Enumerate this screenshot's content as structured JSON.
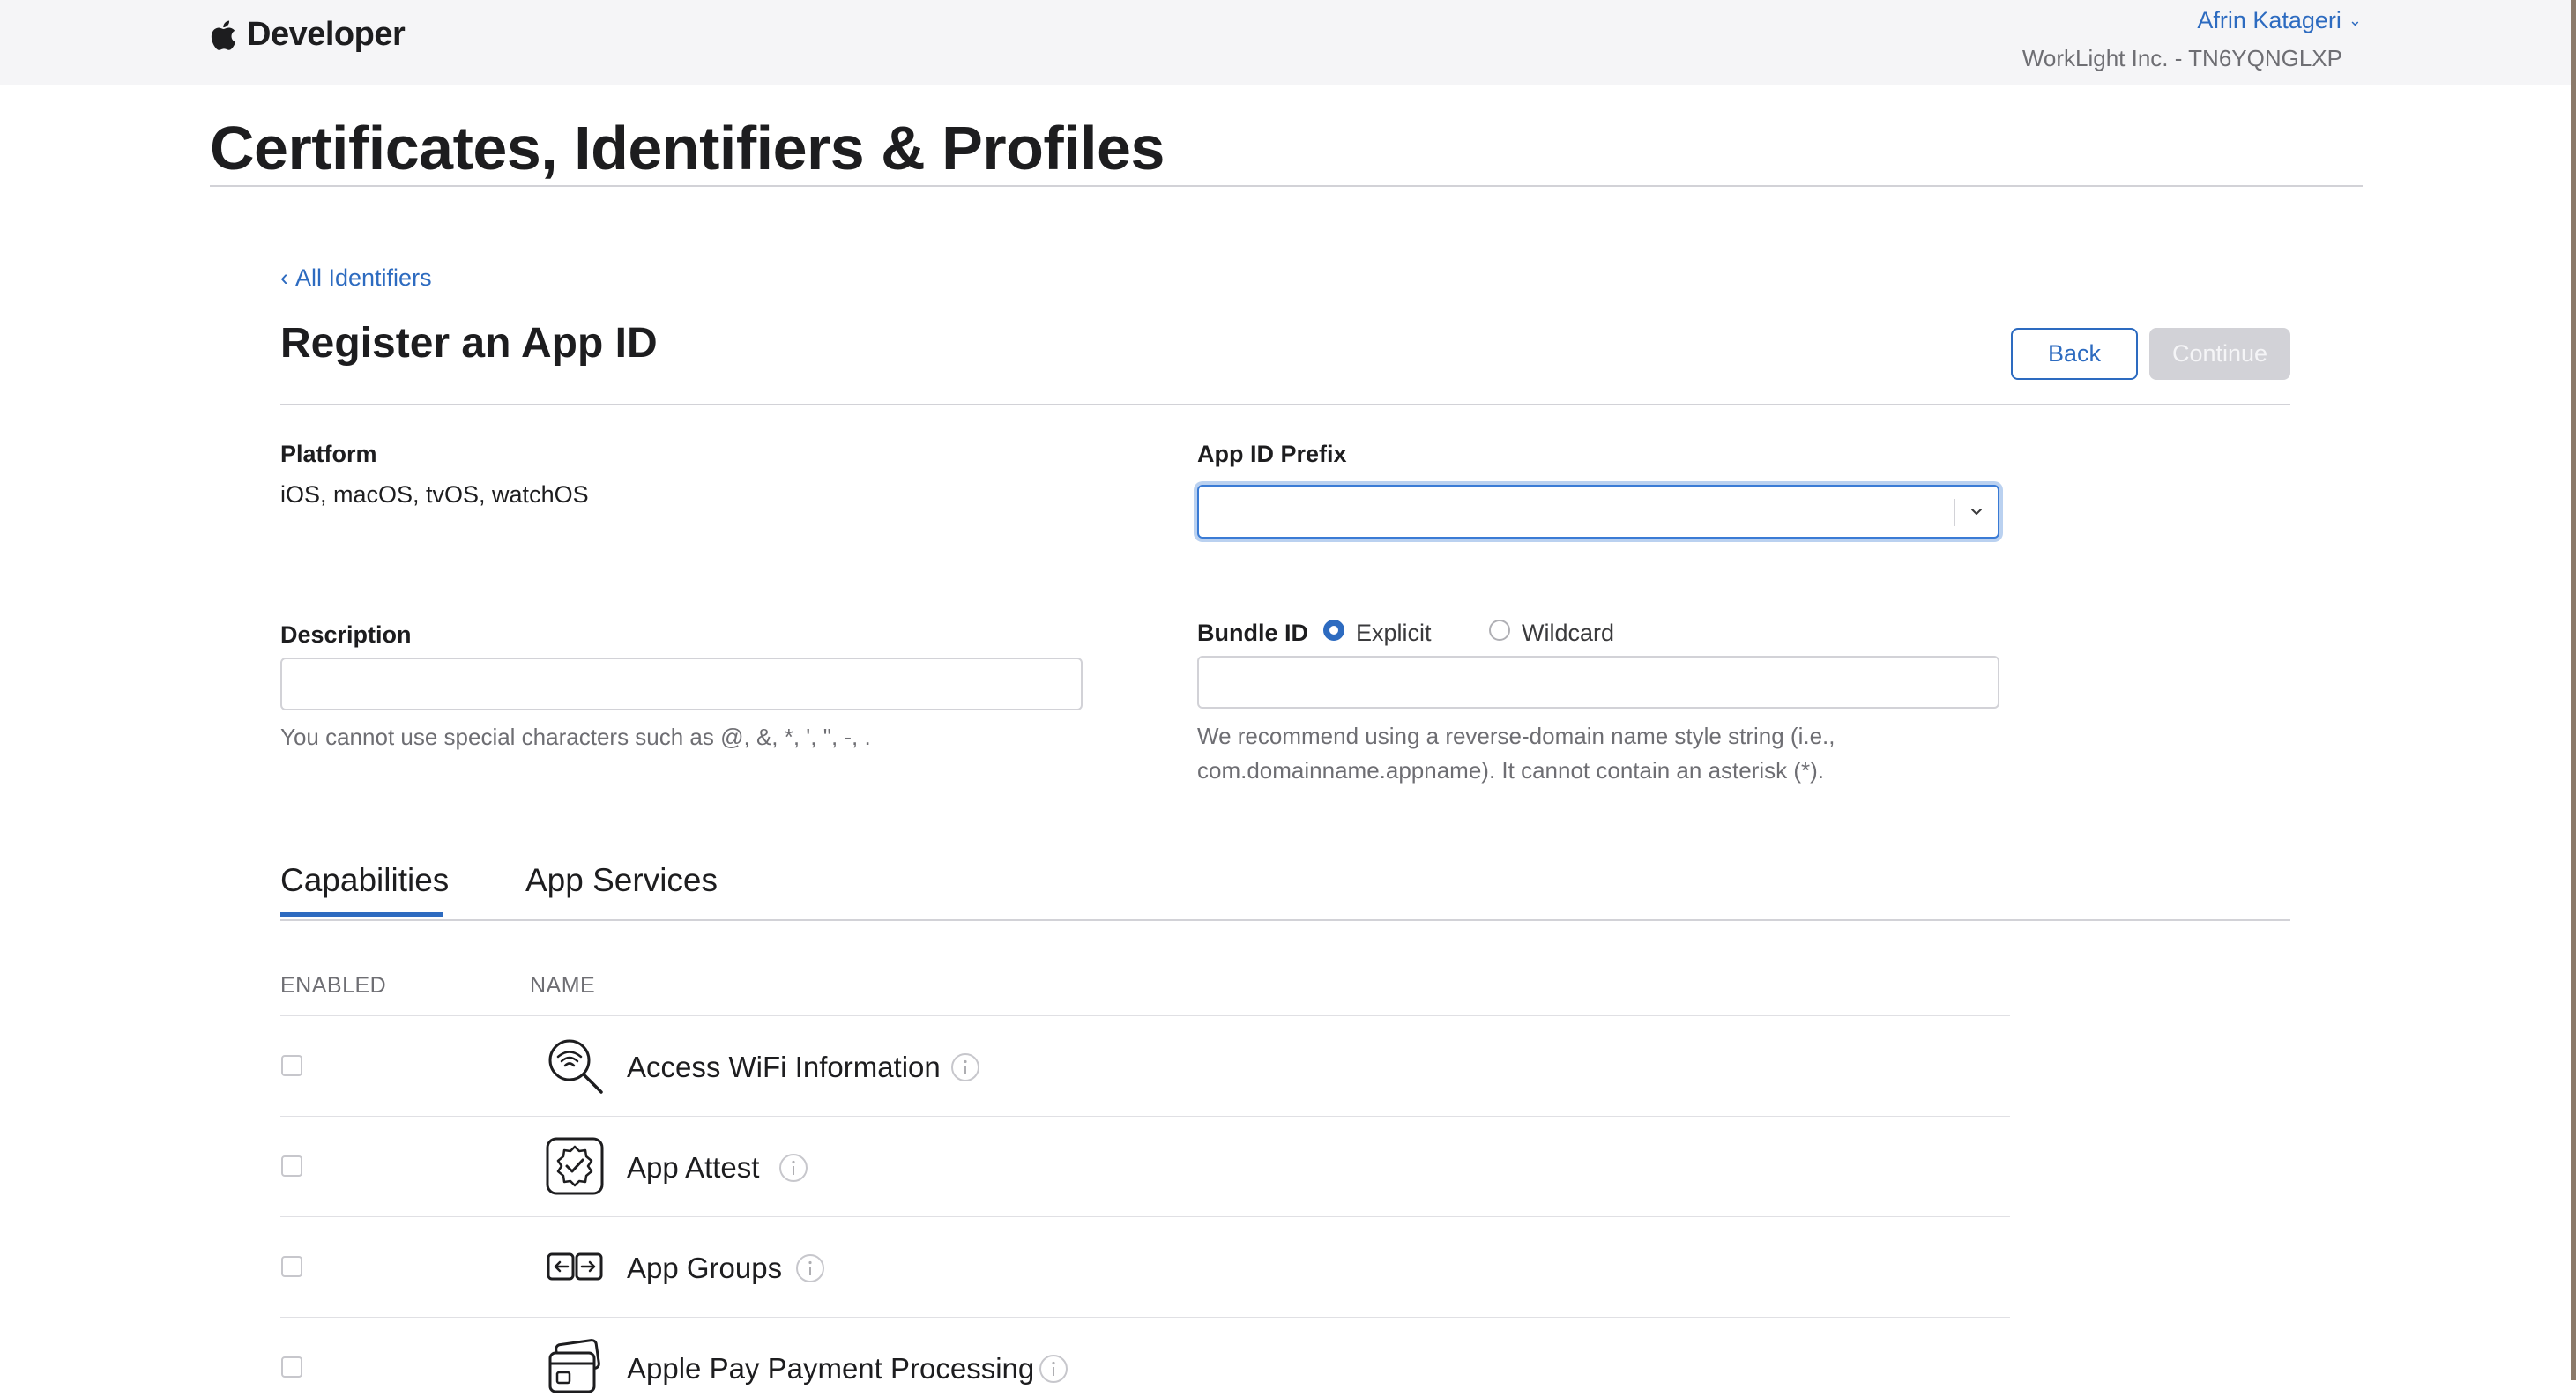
{
  "nav": {
    "brand": "Developer",
    "user_name": "Afrin Katageri",
    "team": "WorkLight Inc. - TN6YQNGLXP"
  },
  "page": {
    "title": "Certificates, Identifiers & Profiles",
    "back_link": "All Identifiers",
    "heading": "Register an App ID",
    "back_button": "Back",
    "continue_button": "Continue"
  },
  "form": {
    "platform_label": "Platform",
    "platform_value": "iOS, macOS, tvOS, watchOS",
    "prefix_label": "App ID Prefix",
    "prefix_value": "",
    "description_label": "Description",
    "description_value": "",
    "description_help": "You cannot use special characters such as @, &, *, ', \", -, .",
    "bundle_label": "Bundle ID",
    "bundle_value": "",
    "bundle_options": [
      "Explicit",
      "Wildcard"
    ],
    "bundle_selected": "Explicit",
    "bundle_help_line1": "We recommend using a reverse-domain name style string (i.e.,",
    "bundle_help_line2": "com.domainname.appname). It cannot contain an asterisk (*)."
  },
  "tabs": [
    "Capabilities",
    "App Services"
  ],
  "active_tab": "Capabilities",
  "table": {
    "columns": [
      "ENABLED",
      "NAME"
    ],
    "rows": [
      {
        "name": "Access WiFi Information",
        "icon": "wifi-search-icon",
        "enabled": false
      },
      {
        "name": "App Attest",
        "icon": "app-attest-badge-icon",
        "enabled": false
      },
      {
        "name": "App Groups",
        "icon": "app-groups-arrows-icon",
        "enabled": false
      },
      {
        "name": "Apple Pay Payment Processing",
        "icon": "apple-pay-cards-icon",
        "enabled": false
      }
    ]
  },
  "colors": {
    "link": "#2d6bc0",
    "header_bg": "#f5f5f7",
    "disabled_button": "#d2d2d7"
  }
}
